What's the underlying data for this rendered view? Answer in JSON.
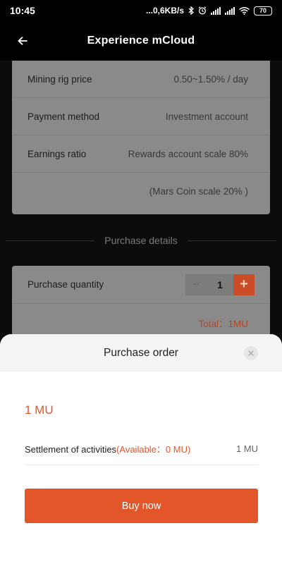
{
  "status_bar": {
    "time": "10:45",
    "network_speed": "...0,6KB/s",
    "battery": "70"
  },
  "header": {
    "back_icon": "arrow-left-icon",
    "title": "Experience mCloud"
  },
  "info_card": {
    "rows": [
      {
        "label": "Mining rig price",
        "value": "0.50~1.50% / day"
      },
      {
        "label": "Payment method",
        "value": "Investment account"
      },
      {
        "label": "Earnings ratio",
        "value": "Rewards account scale 80%"
      }
    ],
    "note": "(Mars Coin scale 20% )"
  },
  "purchase_details": {
    "heading": "Purchase details",
    "quantity_label": "Purchase quantity",
    "quantity_value": "1",
    "minus_symbol": "−",
    "plus_symbol": "+",
    "total": "Total：1MU"
  },
  "sheet": {
    "title": "Purchase order",
    "amount": "1 MU",
    "settlement_label": "Settlement of activities",
    "settlement_available": "(Available：0 MU)",
    "settlement_value": "1 MU",
    "buy_label": "Buy now"
  },
  "colors": {
    "accent": "#e2562a",
    "background": "#000000",
    "dimmed_card": "#8a8a8a"
  }
}
